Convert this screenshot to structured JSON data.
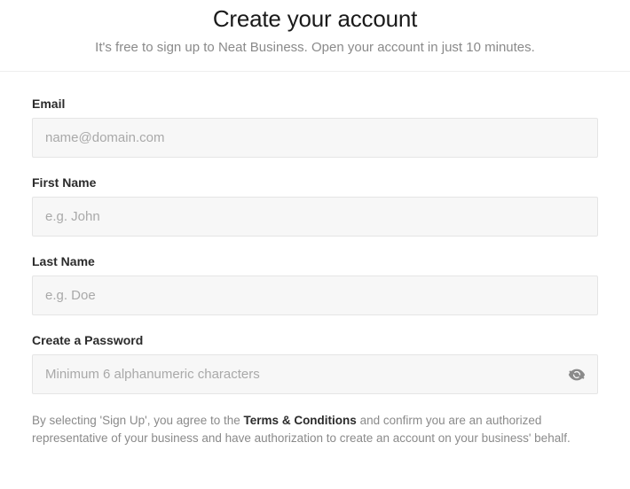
{
  "header": {
    "title": "Create your account",
    "subtitle": "It's free to sign up to Neat Business. Open your account in just 10 minutes."
  },
  "form": {
    "email": {
      "label": "Email",
      "placeholder": "name@domain.com",
      "value": ""
    },
    "first_name": {
      "label": "First Name",
      "placeholder": "e.g. John",
      "value": ""
    },
    "last_name": {
      "label": "Last Name",
      "placeholder": "e.g. Doe",
      "value": ""
    },
    "password": {
      "label": "Create a Password",
      "placeholder": "Minimum 6 alphanumeric characters",
      "value": ""
    }
  },
  "disclaimer": {
    "pre": "By selecting 'Sign Up', you agree to the ",
    "link": "Terms & Conditions",
    "post": " and confirm you are an authorized representative of your business and have authorization to create an account on your business' behalf."
  }
}
